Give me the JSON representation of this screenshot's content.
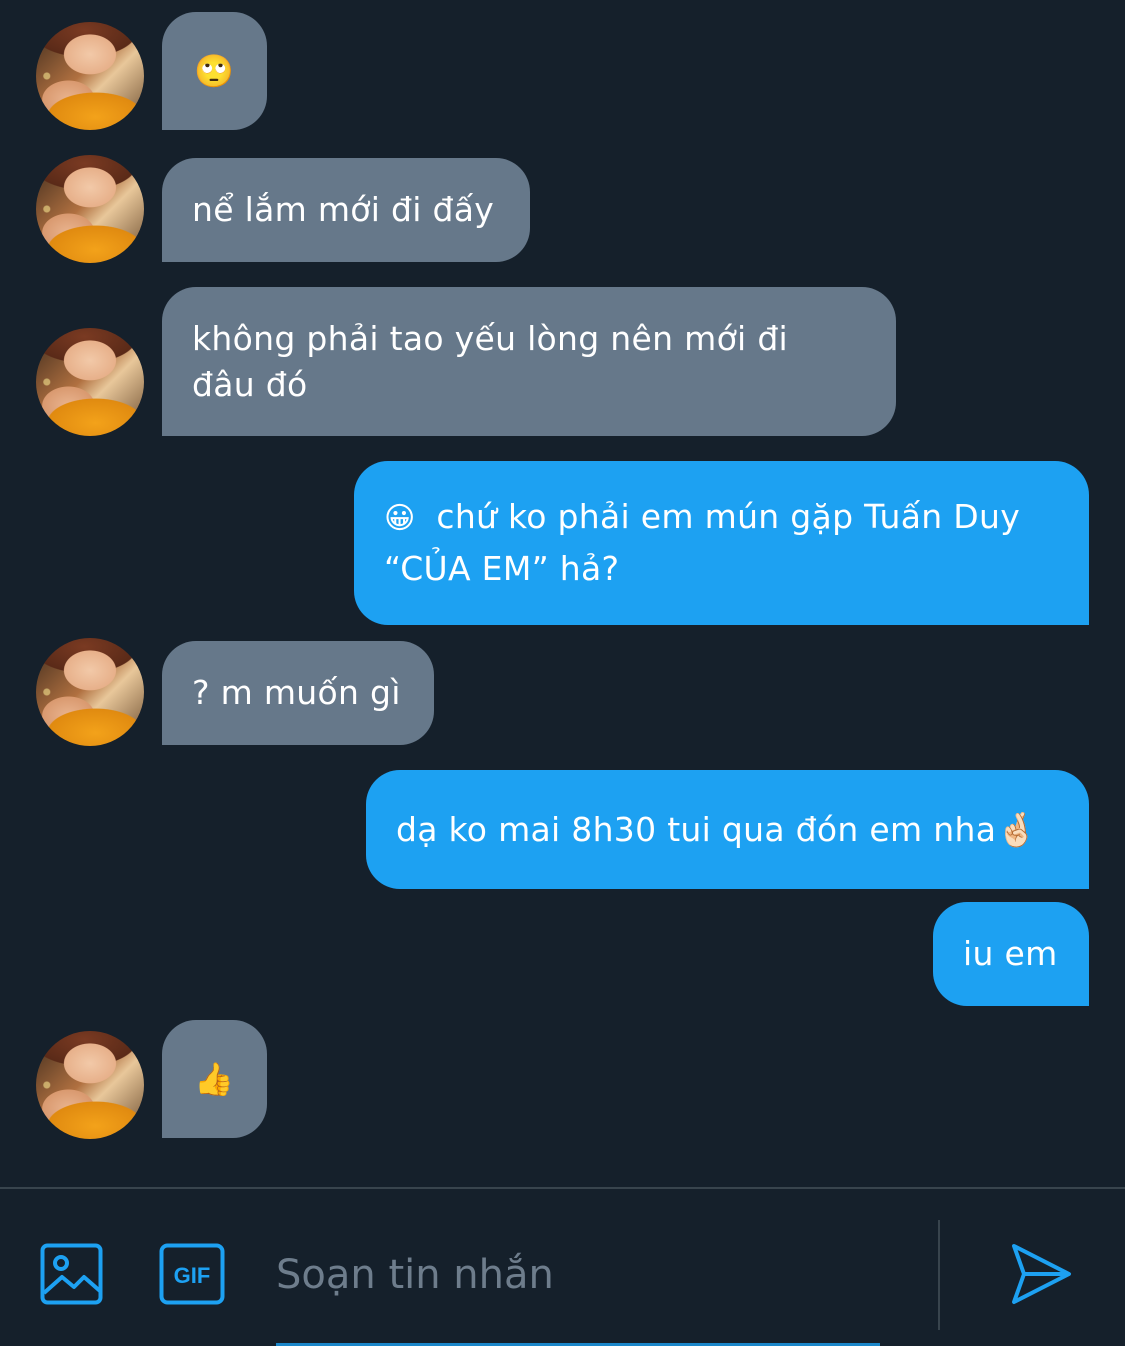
{
  "conversation": {
    "messages": [
      {
        "direction": "in",
        "emoji": "🙄",
        "text": ""
      },
      {
        "direction": "in",
        "emoji": "",
        "text": "nể lắm mới đi đấy"
      },
      {
        "direction": "in",
        "emoji": "",
        "text": "không phải tao yếu lòng nên mới đi đâu đó"
      },
      {
        "direction": "out",
        "emoji": "😀",
        "text": "chứ ko phải em mún gặp Tuấn Duy “CỦA EM” hả?"
      },
      {
        "direction": "in",
        "emoji": "",
        "text": "? m muốn gì"
      },
      {
        "direction": "out",
        "emoji": "",
        "text": "dạ ko mai 8h30 tui qua đón em nha🤞🏻"
      },
      {
        "direction": "out",
        "emoji": "",
        "text": "iu em"
      },
      {
        "direction": "in",
        "emoji": "👍",
        "text": ""
      }
    ]
  },
  "composer": {
    "placeholder": "Soạn tin nhắn",
    "gif_label": "GIF",
    "icons": {
      "media": "image-icon",
      "gif": "gif-icon",
      "send": "send-icon"
    }
  },
  "colors": {
    "background": "#15202b",
    "incoming_bubble": "#66788a",
    "outgoing_bubble": "#1da1f2",
    "accent": "#1da1f2"
  }
}
